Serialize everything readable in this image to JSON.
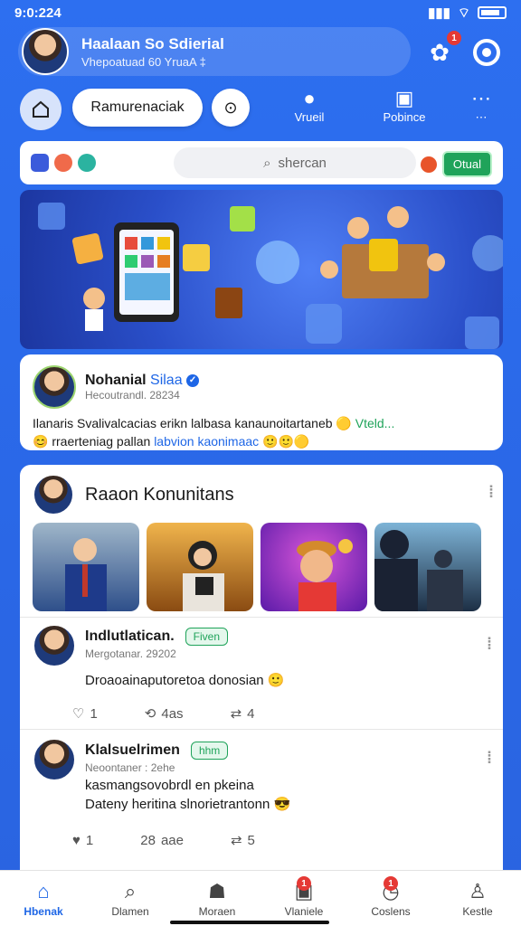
{
  "status": {
    "time": "9:0:224"
  },
  "profile": {
    "name": "Haalaan So Sdierial",
    "subtitle": "Vhepoatuad 60  YruaA ‡"
  },
  "header": {
    "notif_badge": "1"
  },
  "nav": {
    "pill_label": "Ramurenaciak",
    "links": [
      {
        "label": "Vrueil",
        "icon": "chat-icon"
      },
      {
        "label": "Pobince",
        "icon": "page-icon"
      },
      {
        "label": "",
        "icon": "more-icon"
      }
    ]
  },
  "search": {
    "placeholder": "shercan",
    "action_label": "Otual"
  },
  "post": {
    "name": "Nohanial",
    "name_highlight": "Silaa",
    "meta": "Hecoutrandl. 28234",
    "line1": "Ilanaris Svalivalcacias erikn lalbasa kanaunoitartaneb",
    "line1_green": "Vteld...",
    "line2": "rraerteniag pallan",
    "line2_blue": "labvion kaonimaac"
  },
  "community": {
    "title": "Raaon Konunitans",
    "thumbs": [
      {
        "label": "presenter-thumbnail"
      },
      {
        "label": "woman-thumbnail"
      },
      {
        "label": "cartoon-thumbnail"
      },
      {
        "label": "audience-thumbnail"
      }
    ]
  },
  "feed": [
    {
      "name": "Indlutlatican.",
      "tag": "Fiven",
      "meta": "Mergotanar. 29202",
      "text": [
        "Droaoainaputoretoa donosian"
      ],
      "likes": "1",
      "comments": "4as",
      "shares": "4"
    },
    {
      "name": "Klalsuelrimen",
      "tag": "hhm",
      "meta": "Neoontaner : 2ehe",
      "text": [
        "kasmangsovobrdl en pkeina",
        "Dateny heritina slnorietrantonn"
      ],
      "likes": "1",
      "comments": "aae",
      "shares": "5"
    }
  ],
  "bottom_nav": [
    {
      "label": "Hbenak",
      "icon": "home-icon",
      "active": true,
      "badge": ""
    },
    {
      "label": "Dlamen",
      "icon": "search-icon",
      "active": false,
      "badge": ""
    },
    {
      "label": "Moraen",
      "icon": "user-icon",
      "active": false,
      "badge": ""
    },
    {
      "label": "Vlaniele",
      "icon": "book-icon",
      "active": false,
      "badge": "1"
    },
    {
      "label": "Coslens",
      "icon": "clock-icon",
      "active": false,
      "badge": "1"
    },
    {
      "label": "Kestle",
      "icon": "person-icon",
      "active": false,
      "badge": ""
    }
  ],
  "colors": {
    "brand": "#2d6ff0",
    "accent_green": "#1fa35a",
    "badge_red": "#e53935"
  }
}
